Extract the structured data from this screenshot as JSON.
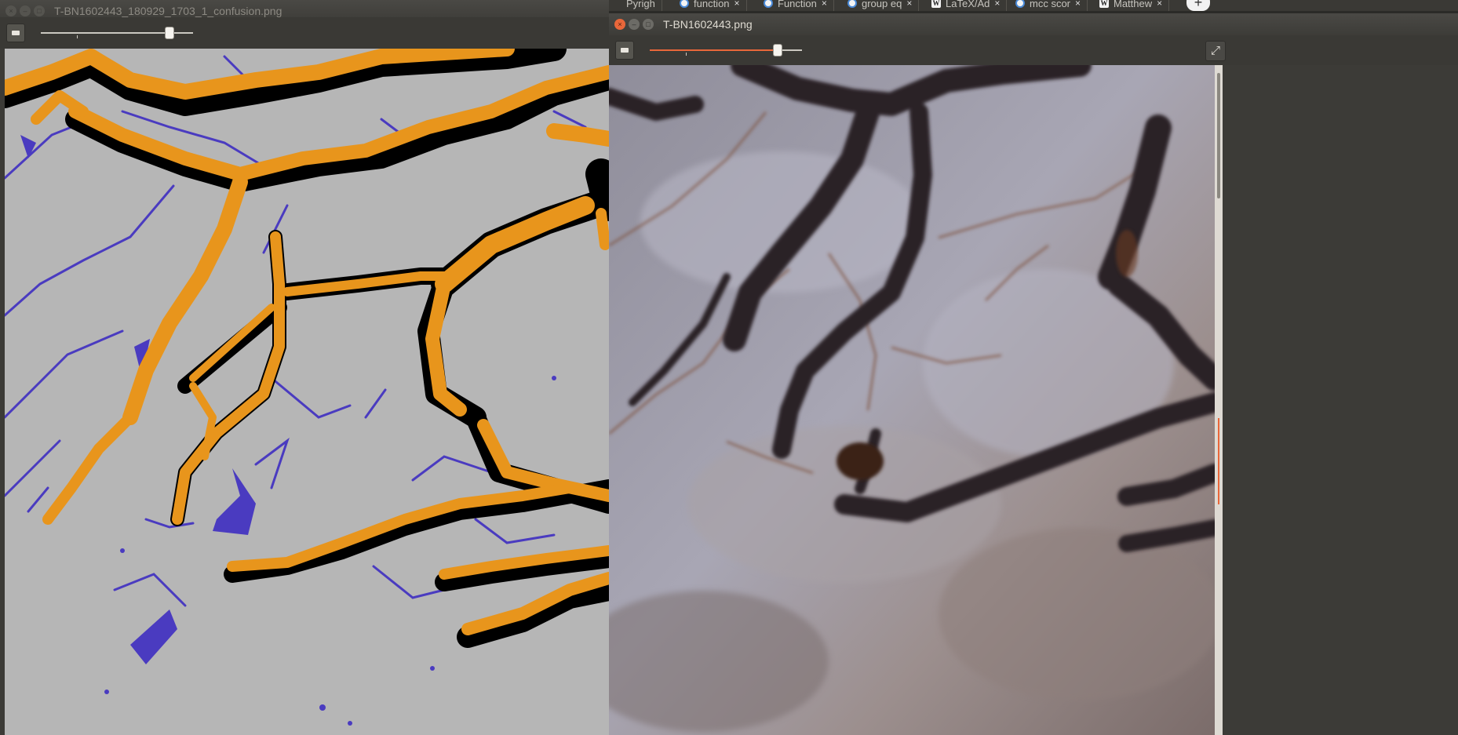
{
  "browser_tabs": [
    {
      "label": "function",
      "icon": "chrome-icon"
    },
    {
      "label": "Function",
      "icon": "chrome-icon"
    },
    {
      "label": "group eq",
      "icon": "chrome-icon"
    },
    {
      "label": "LaTeX/Ad",
      "icon": "wikibooks-icon"
    },
    {
      "label": "mcc scor",
      "icon": "chrome-icon"
    },
    {
      "label": "Matthew",
      "icon": "wikipedia-icon"
    }
  ],
  "browser_tab_partial": "Pyrigh",
  "new_tab_label": "+",
  "left_window": {
    "title": "T-BN1602443_180929_1703_1_confusion.png",
    "zoom_fraction": 1.0,
    "active": false
  },
  "right_window": {
    "title": "T-BN1602443.png",
    "zoom_fraction": 1.0,
    "active": true
  },
  "glyphs": {
    "close": "×",
    "minimize": "–",
    "maximize": "□",
    "fullscreen": "⤢"
  },
  "colors": {
    "true_positive": "#e8951c",
    "false_negative": "#000000",
    "false_positive": "#4a3bc0",
    "background": "#b6b6b6",
    "accent": "#e9673a"
  }
}
